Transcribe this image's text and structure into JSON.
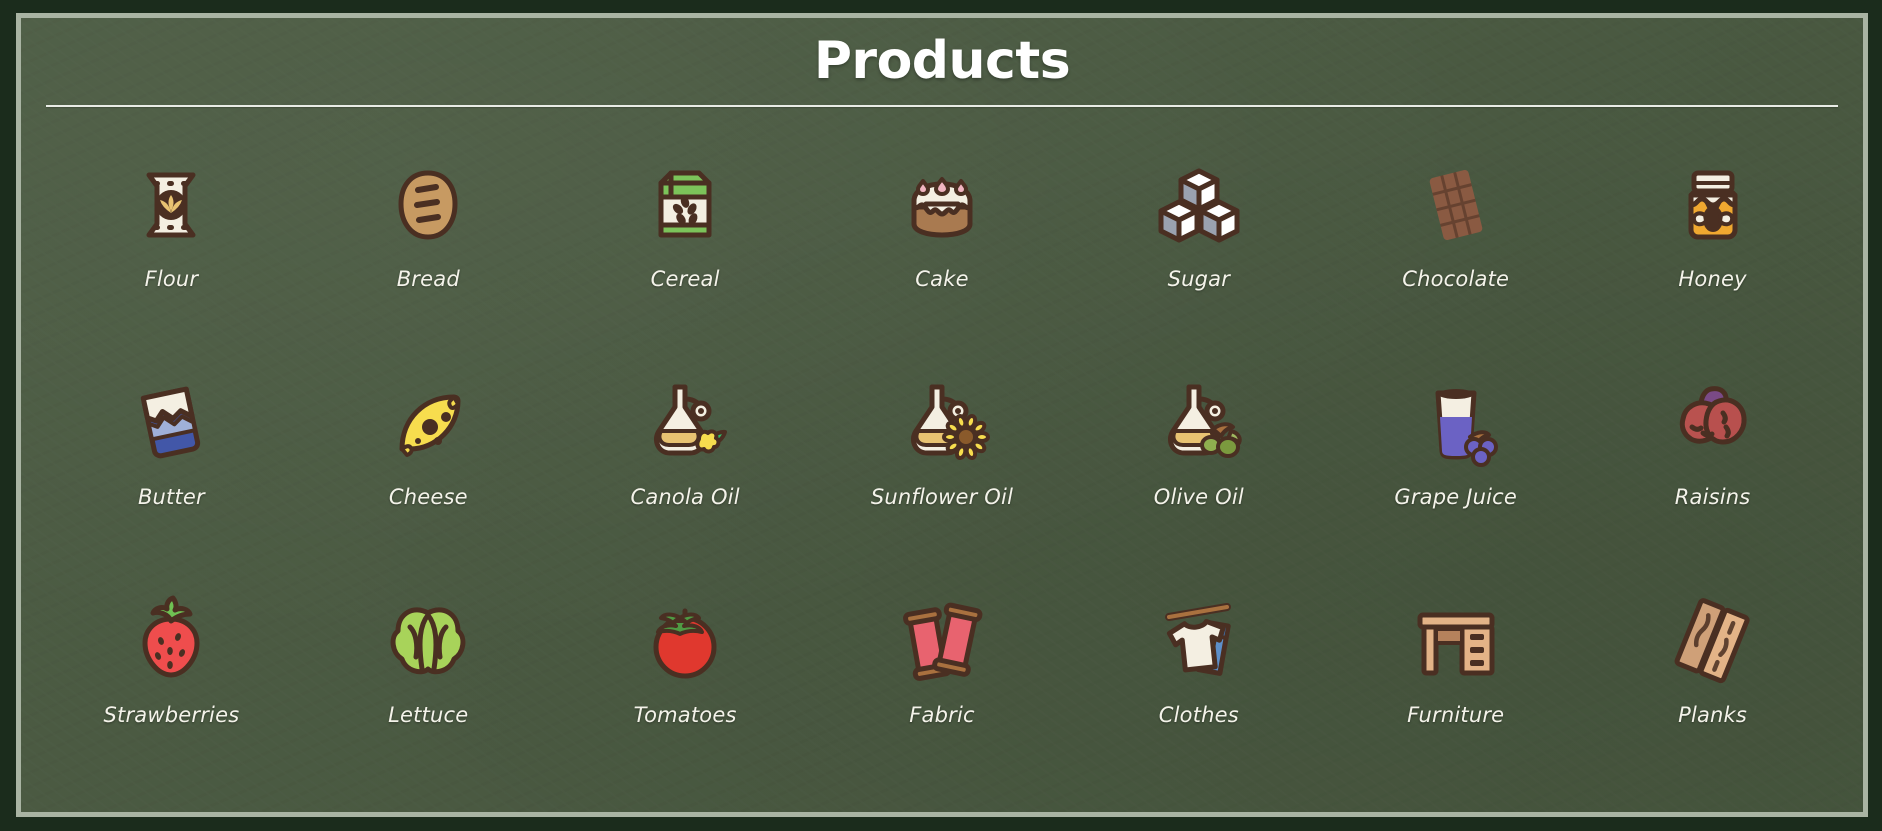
{
  "header": {
    "title": "Products",
    "divider": true
  },
  "colors": {
    "outer_background": "#1b2c1c",
    "panel_background": "#4a5a41",
    "panel_border": "#a9b4a3",
    "title_text": "#ffffff",
    "label_text": "#f4f3ea",
    "outline": "#4a2f22",
    "cream": "#f4efe2",
    "wheat_gold": "#e8c372",
    "bread_tan": "#c79a62",
    "cereal_green": "#7cc35a",
    "cake_brown": "#a97a50",
    "sugar_white": "#ffffff",
    "sugar_gray": "#9aa2b0",
    "chocolate_brown": "#8a5a42",
    "honey_amber": "#f0a830",
    "butter_blue": "#4257a8",
    "cheese_yellow": "#f7dd4e",
    "olive_green": "#8fae4f",
    "grape_purple": "#6b62c4",
    "raisin_red": "#b9524f",
    "strawberry_red": "#ef4d4d",
    "lettuce_green": "#a8d35a",
    "tomato_red": "#e0382e",
    "fabric_pink": "#e8636f",
    "clothes_blue": "#5d8fc9",
    "wood_tan": "#e3b387"
  },
  "grid": {
    "columns": 7,
    "rows": 3,
    "items": [
      {
        "label": "Flour",
        "icon": "flour-icon"
      },
      {
        "label": "Bread",
        "icon": "bread-icon"
      },
      {
        "label": "Cereal",
        "icon": "cereal-icon"
      },
      {
        "label": "Cake",
        "icon": "cake-icon"
      },
      {
        "label": "Sugar",
        "icon": "sugar-icon"
      },
      {
        "label": "Chocolate",
        "icon": "chocolate-icon"
      },
      {
        "label": "Honey",
        "icon": "honey-icon"
      },
      {
        "label": "Butter",
        "icon": "butter-icon"
      },
      {
        "label": "Cheese",
        "icon": "cheese-icon"
      },
      {
        "label": "Canola Oil",
        "icon": "canola-oil-icon"
      },
      {
        "label": "Sunflower Oil",
        "icon": "sunflower-oil-icon"
      },
      {
        "label": "Olive Oil",
        "icon": "olive-oil-icon"
      },
      {
        "label": "Grape Juice",
        "icon": "grape-juice-icon"
      },
      {
        "label": "Raisins",
        "icon": "raisins-icon"
      },
      {
        "label": "Strawberries",
        "icon": "strawberries-icon"
      },
      {
        "label": "Lettuce",
        "icon": "lettuce-icon"
      },
      {
        "label": "Tomatoes",
        "icon": "tomatoes-icon"
      },
      {
        "label": "Fabric",
        "icon": "fabric-icon"
      },
      {
        "label": "Clothes",
        "icon": "clothes-icon"
      },
      {
        "label": "Furniture",
        "icon": "furniture-icon"
      },
      {
        "label": "Planks",
        "icon": "planks-icon"
      }
    ]
  }
}
